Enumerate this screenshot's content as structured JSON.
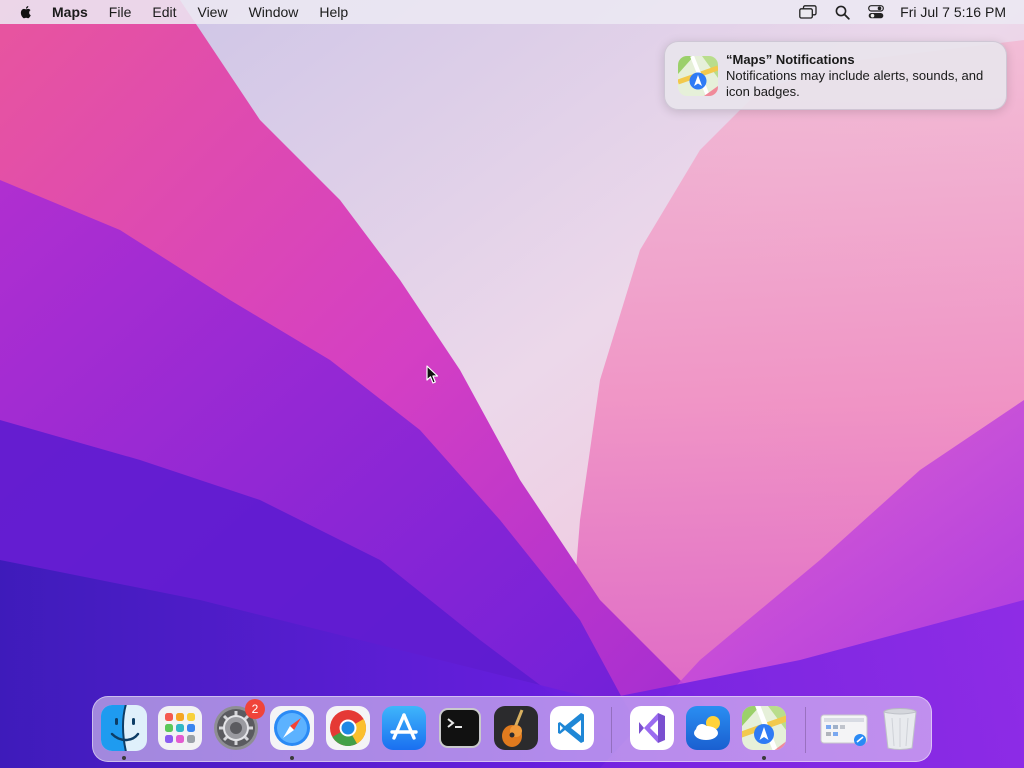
{
  "menubar": {
    "apple_icon": "apple-logo-icon",
    "app_name": "Maps",
    "menus": [
      "File",
      "Edit",
      "View",
      "Window",
      "Help"
    ],
    "status_icons": [
      "screen-mirroring-icon",
      "spotlight-search-icon",
      "control-center-icon"
    ],
    "clock": "Fri Jul 7  5:16 PM"
  },
  "notification": {
    "app_icon": "maps-icon",
    "title": "“Maps” Notifications",
    "body": "Notifications may include alerts, sounds, and icon badges."
  },
  "dock": {
    "items": [
      {
        "name": "Finder",
        "icon": "finder-icon",
        "running": true
      },
      {
        "name": "Launchpad",
        "icon": "launchpad-icon",
        "running": false
      },
      {
        "name": "System Settings",
        "icon": "system-settings-icon",
        "running": false,
        "badge": "2"
      },
      {
        "name": "Safari",
        "icon": "safari-icon",
        "running": true
      },
      {
        "name": "Google Chrome",
        "icon": "chrome-icon",
        "running": false
      },
      {
        "name": "App Store",
        "icon": "app-store-icon",
        "running": false
      },
      {
        "name": "Terminal",
        "icon": "terminal-icon",
        "running": false
      },
      {
        "name": "GarageBand",
        "icon": "garageband-icon",
        "running": false
      },
      {
        "name": "Visual Studio Code",
        "icon": "vscode-icon",
        "running": false
      },
      {
        "name": "Visual Studio",
        "icon": "visual-studio-icon",
        "running": false
      },
      {
        "name": "Weather",
        "icon": "weather-icon",
        "running": false
      },
      {
        "name": "Maps",
        "icon": "maps-icon",
        "running": true
      },
      {
        "name": "Downloads",
        "icon": "downloads-stack-icon",
        "running": false
      },
      {
        "name": "Trash",
        "icon": "trash-icon",
        "running": false
      }
    ]
  },
  "colors": {
    "wallpaper_purple": "#6a1fd6",
    "wallpaper_magenta": "#d23bbd",
    "wallpaper_pink": "#f0a0c8",
    "badge_red": "#f0443a"
  }
}
